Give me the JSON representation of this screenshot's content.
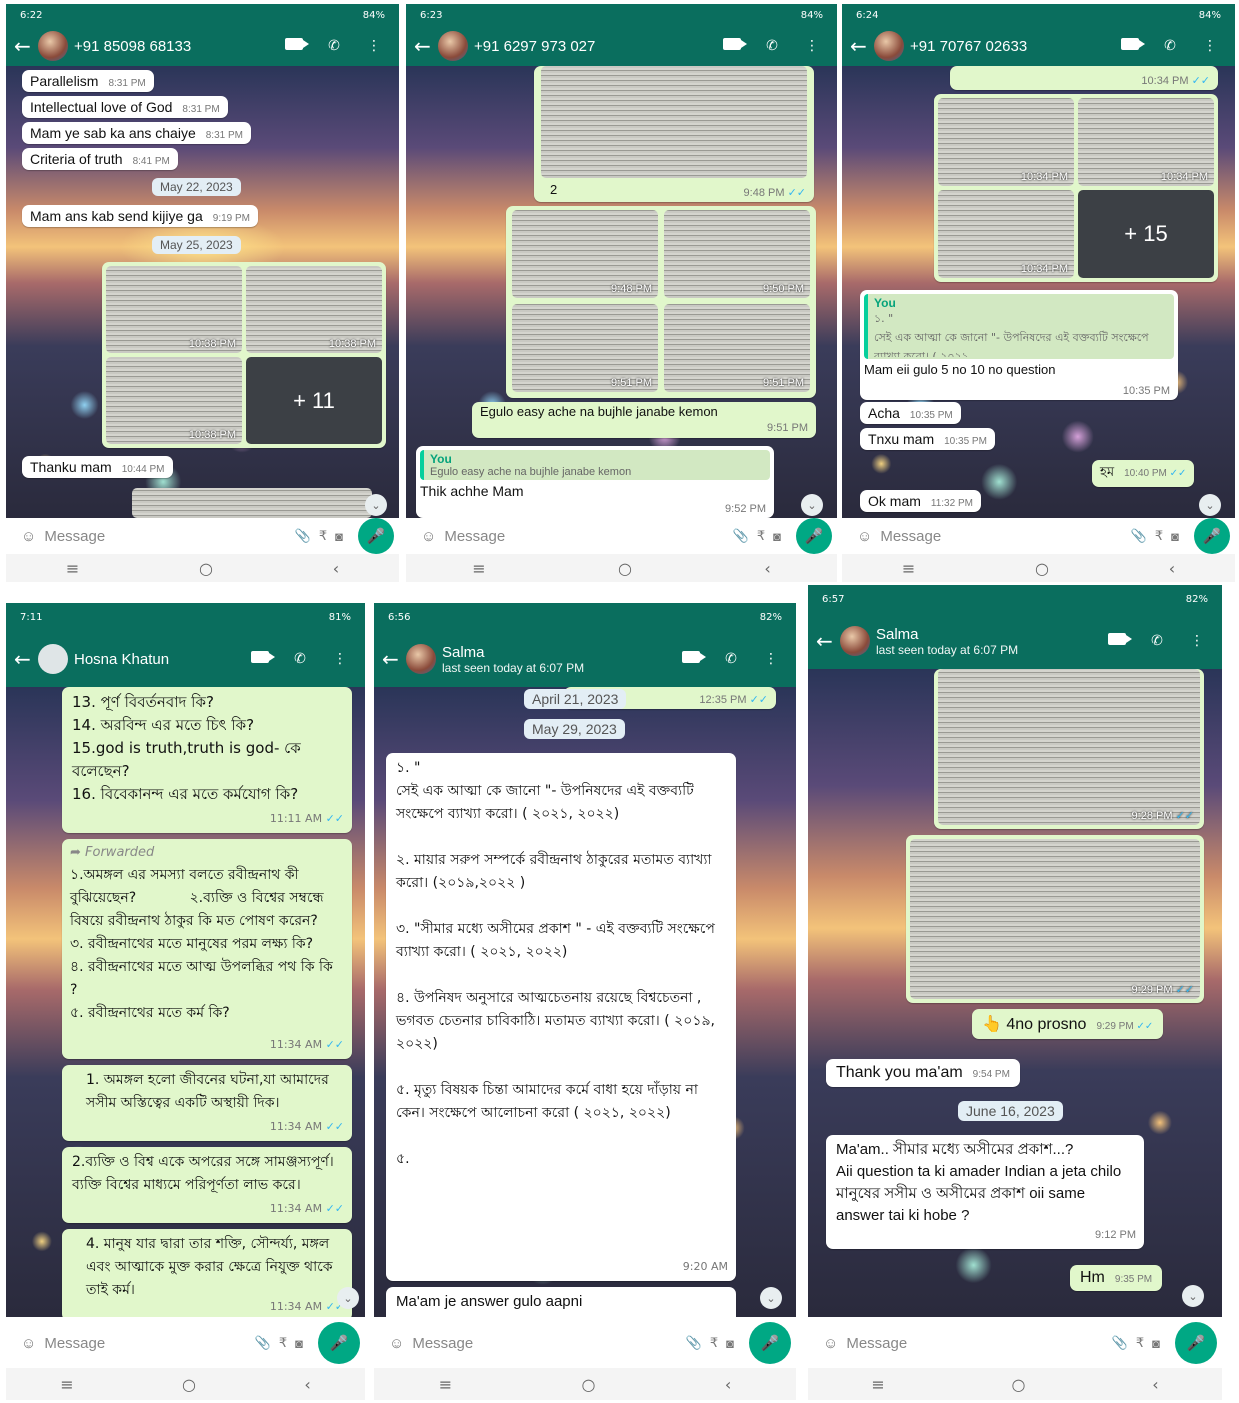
{
  "s1": {
    "time": "6:22",
    "status": "84%",
    "contact": "+91 85098 68133",
    "m1": "Parallelism",
    "t1": "8:31 PM",
    "m2": "Intellectual love of God",
    "t2": "8:31 PM",
    "m3": "Mam ye sab ka ans chaiye",
    "t3": "8:31 PM",
    "m4": "Criteria of truth",
    "t4": "8:41 PM",
    "d1": "May 22, 2023",
    "m5": "Mam ans kab send kijiye ga",
    "t5": "9:19 PM",
    "d2": "May 25, 2023",
    "i1": "10:38 PM",
    "i2": "10:38 PM",
    "i3": "10:38 PM",
    "more": "+ 11",
    "m6": "Thanku mam",
    "t6": "10:44 PM"
  },
  "s2": {
    "time": "6:23",
    "status": "84%",
    "contact": "+91 6297 973 027",
    "cap": "2",
    "t0": "9:48 PM",
    "i1": "9:48 PM",
    "i2": "9:50 PM",
    "i3": "9:51 PM",
    "i4": "9:51 PM",
    "m1": "Egulo easy ache na bujhle janabe kemon",
    "t1": "9:51 PM",
    "qw": "You",
    "q": "Egulo easy ache na bujhle janabe kemon",
    "m2": "Thik achhe Mam",
    "t2": "9:52 PM"
  },
  "s3": {
    "time": "6:24",
    "status": "84%",
    "contact": "+91 70767 02633",
    "t0": "10:34 PM",
    "i1": "10:34 PM",
    "i2": "10:34 PM",
    "i3": "10:34 PM",
    "more": "+ 15",
    "qw": "You",
    "q1": "১. \"",
    "q2": "সেই এক আত্মা কে জানো \"- উপনিষদের এই বক্তব্যটি সংক্ষেপে ব্যাখ্যা করো। ( ২০২১,...",
    "m1": "Mam eii gulo 5 no 10 no question",
    "t1": "10:35 PM",
    "m2": "Acha",
    "t2": "10:35 PM",
    "m3": "Tnxu mam",
    "t3": "10:35 PM",
    "m4": "হম",
    "t4": "10:40 PM",
    "m5": "Ok mam",
    "t5": "11:32 PM"
  },
  "s4": {
    "time": "7:11",
    "status": "81%",
    "contact": "Hosna Khatun",
    "b1": "13. পূর্ণ বিবর্তনবাদ কি?\n14. অরবিন্দ এর মতে চিৎ কি?\n15.god is truth,truth is god- কে বলেছেন?\n16. বিবেকানন্দ এর মতে কর্মযোগ কি?",
    "t1": "11:11 AM",
    "fw": "Forwarded",
    "b2": "১.অমঙ্গল এর সমস্যা বলতে রবীন্দ্রনাথ কী বুঝিয়েছেন?            ২.ব্যক্তি ও বিশ্বের সম্বন্ধে বিষয়ে রবীন্দ্রনাথ ঠাকুর কি মত পোষণ করেন?\n৩. রবীন্দ্রনাথের মতে মানুষের পরম লক্ষ্য কি?          ৪. রবীন্দ্রনাথের মতে আত্ম উপলব্ধির পথ কি কি ?\n৫. রবীন্দ্রনাথের মতে কর্ম কি?",
    "t2": "11:34 AM",
    "b3": "1. অমঙ্গল হলো জীবনের ঘটনা,যা আমাদের সসীম অস্তিত্বের একটি অস্থায়ী দিক।",
    "t3": "11:34 AM",
    "b4": "2.ব্যক্তি ও বিশ্ব একে অপরের সঙ্গে সামঞ্জস্যপূর্ণ। ব্যক্তি বিশ্বের মাধ্যমে পরিপূর্ণতা লাভ করে।",
    "t4": "11:34 AM",
    "b5": "4. মানুষ যার দ্বারা তার শক্তি, সৌন্দর্য্য, মঙ্গল এবং আত্মাকে মুক্ত করার ক্ষেত্রে নিযুক্ত থাকে তাই কর্ম।",
    "t5": "11:34 AM"
  },
  "s5": {
    "time": "6:56",
    "status": "82%",
    "contact": "Salma",
    "seen": "last seen today at 6:07 PM",
    "d1": "April 21, 2023",
    "t0": "12:35 PM",
    "d2": "May 29, 2023",
    "b1": "১. \"\nসেই এক আত্মা কে জানো \"- উপনিষদের এই বক্তব্যটি সংক্ষেপে ব্যাখ্যা করো। ( ২০২১, ২০২২)\n\n২. মায়ার সরুপ সম্পর্কে রবীন্দ্রনাথ ঠাকুরের মতামত ব্যাখ্যা করো। (২০১৯,২০২২ )\n\n৩. \"সীমার মধ্যে অসীমের প্রকাশ \" - এই বক্তব্যটি সংক্ষেপে ব্যাখ্যা করো। ( ২০২১, ২০২২)\n\n৪. উপনিষদ অনুসারে আত্মচেতনায় রয়েছে বিশ্বচেতনা , ভগবত চেতনার চাবিকাঠি। মতামত ব্যাখ্যা করো। ( ২০১৯, ২০২২)\n\n৫. মৃত্যু বিষয়ক চিন্তা আমাদের কর্মে বাধা হয়ে দাঁড়ায় না কেন। সংক্ষেপে আলোচনা করো ( ২০২১, ২০২২)\n\n৫.",
    "t1": "9:20 AM",
    "b2": "Ma'am je answer gulo aapni"
  },
  "s6": {
    "time": "6:57",
    "status": "82%",
    "contact": "Salma",
    "seen": "last seen today at 6:07 PM",
    "i1": "9:28 PM",
    "i2": "9:29 PM",
    "m1": "👆 4no prosno",
    "t1": "9:29 PM",
    "m2": "Thank you ma'am",
    "t2": "9:54 PM",
    "d1": "June 16, 2023",
    "b1": "Ma'am.. সীমার মধ্যে অসীমের প্রকাশ...?\nAii question ta ki amader Indian a jeta chilo মানুষের সসীম ও অসীমের প্রকাশ oii same answer tai ki hobe ?",
    "t3": "9:12 PM",
    "m3": "Hm",
    "t4": "9:35 PM"
  },
  "common": {
    "placeholder": "Message",
    "nav1": "≡",
    "nav2": "○",
    "nav3": "‹"
  },
  "colors": {
    "header": "#0a6e5e",
    "outgoing": "#e1f7cb",
    "incoming": "#ffffff",
    "accent": "#00a884"
  }
}
